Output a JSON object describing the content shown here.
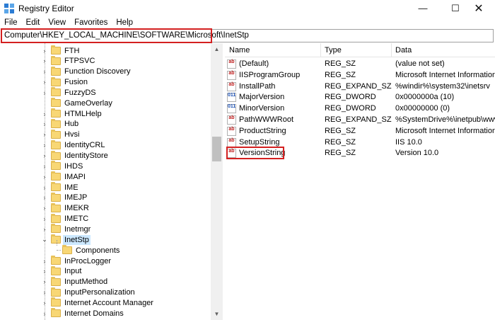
{
  "window": {
    "title": "Registry Editor",
    "minimize": "—",
    "maximize": "☐",
    "close": "✕"
  },
  "menu": [
    "File",
    "Edit",
    "View",
    "Favorites",
    "Help"
  ],
  "address": "Computer\\HKEY_LOCAL_MACHINE\\SOFTWARE\\Microsoft\\InetStp",
  "tree": [
    {
      "label": "FTH",
      "expander": "›"
    },
    {
      "label": "FTPSVC",
      "expander": "›"
    },
    {
      "label": "Function Discovery",
      "expander": "›"
    },
    {
      "label": "Fusion",
      "expander": "›"
    },
    {
      "label": "FuzzyDS",
      "expander": "›"
    },
    {
      "label": "GameOverlay",
      "expander": ""
    },
    {
      "label": "HTMLHelp",
      "expander": "›"
    },
    {
      "label": "Hub",
      "expander": "›"
    },
    {
      "label": "Hvsi",
      "expander": "›"
    },
    {
      "label": "IdentityCRL",
      "expander": "›"
    },
    {
      "label": "IdentityStore",
      "expander": "›"
    },
    {
      "label": "IHDS",
      "expander": "›"
    },
    {
      "label": "IMAPI",
      "expander": "›"
    },
    {
      "label": "IME",
      "expander": "›"
    },
    {
      "label": "IMEJP",
      "expander": "›"
    },
    {
      "label": "IMEKR",
      "expander": "›"
    },
    {
      "label": "IMETC",
      "expander": "›"
    },
    {
      "label": "Inetmgr",
      "expander": "›"
    },
    {
      "label": "InetStp",
      "expander": "⌄",
      "selected": true
    },
    {
      "label": "Components",
      "expander": "",
      "child": true
    },
    {
      "label": "InProcLogger",
      "expander": "›"
    },
    {
      "label": "Input",
      "expander": "›"
    },
    {
      "label": "InputMethod",
      "expander": "›"
    },
    {
      "label": "InputPersonalization",
      "expander": "›"
    },
    {
      "label": "Internet Account Manager",
      "expander": "›"
    },
    {
      "label": "Internet Domains",
      "expander": "›"
    }
  ],
  "list": {
    "headers": {
      "name": "Name",
      "type": "Type",
      "data": "Data"
    },
    "rows": [
      {
        "icon": "ab",
        "name": "(Default)",
        "type": "REG_SZ",
        "data": "(value not set)"
      },
      {
        "icon": "ab",
        "name": "IISProgramGroup",
        "type": "REG_SZ",
        "data": "Microsoft Internet Information S"
      },
      {
        "icon": "ab",
        "name": "InstallPath",
        "type": "REG_EXPAND_SZ",
        "data": "%windir%\\system32\\inetsrv"
      },
      {
        "icon": "011",
        "name": "MajorVersion",
        "type": "REG_DWORD",
        "data": "0x0000000a (10)"
      },
      {
        "icon": "011",
        "name": "MinorVersion",
        "type": "REG_DWORD",
        "data": "0x00000000 (0)"
      },
      {
        "icon": "ab",
        "name": "PathWWWRoot",
        "type": "REG_EXPAND_SZ",
        "data": "%SystemDrive%\\inetpub\\wwwr"
      },
      {
        "icon": "ab",
        "name": "ProductString",
        "type": "REG_SZ",
        "data": "Microsoft Internet Information S"
      },
      {
        "icon": "ab",
        "name": "SetupString",
        "type": "REG_SZ",
        "data": "IIS 10.0"
      },
      {
        "icon": "ab",
        "name": "VersionString",
        "type": "REG_SZ",
        "data": "Version 10.0"
      }
    ]
  },
  "scrollbar": {
    "up": "▲",
    "down": "▼"
  },
  "colors": {
    "highlight": "#d42020",
    "selection": "#cce8ff",
    "folder": "#f8d775"
  }
}
